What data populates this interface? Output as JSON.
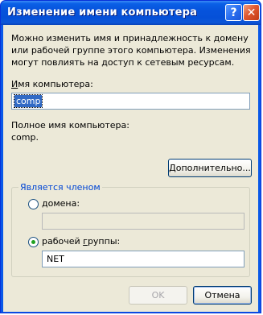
{
  "window": {
    "title": "Изменение имени компьютера",
    "help_glyph": "?",
    "close_glyph": "✕"
  },
  "description": "Можно изменить имя и принадлежность к домену или рабочей группе этого компьютера. Изменения могут повлиять на доступ к сетевым ресурсам.",
  "computer_name": {
    "label_prefix": "",
    "label_mnemonic": "И",
    "label_rest": "мя компьютера:",
    "value": "comp"
  },
  "full_name": {
    "label": "Полное имя компьютера:",
    "value": "comp."
  },
  "more_button": {
    "mnemonic": "Д",
    "rest": "ополнительно..."
  },
  "membership": {
    "legend": "Является членом",
    "domain": {
      "label_mnemonic": "д",
      "label_rest": "омена:",
      "value": "",
      "selected": false
    },
    "workgroup": {
      "label_pre": "рабочей ",
      "label_mnemonic": "г",
      "label_rest": "руппы:",
      "value": "NET",
      "selected": true
    }
  },
  "buttons": {
    "ok": "OK",
    "cancel": "Отмена"
  }
}
